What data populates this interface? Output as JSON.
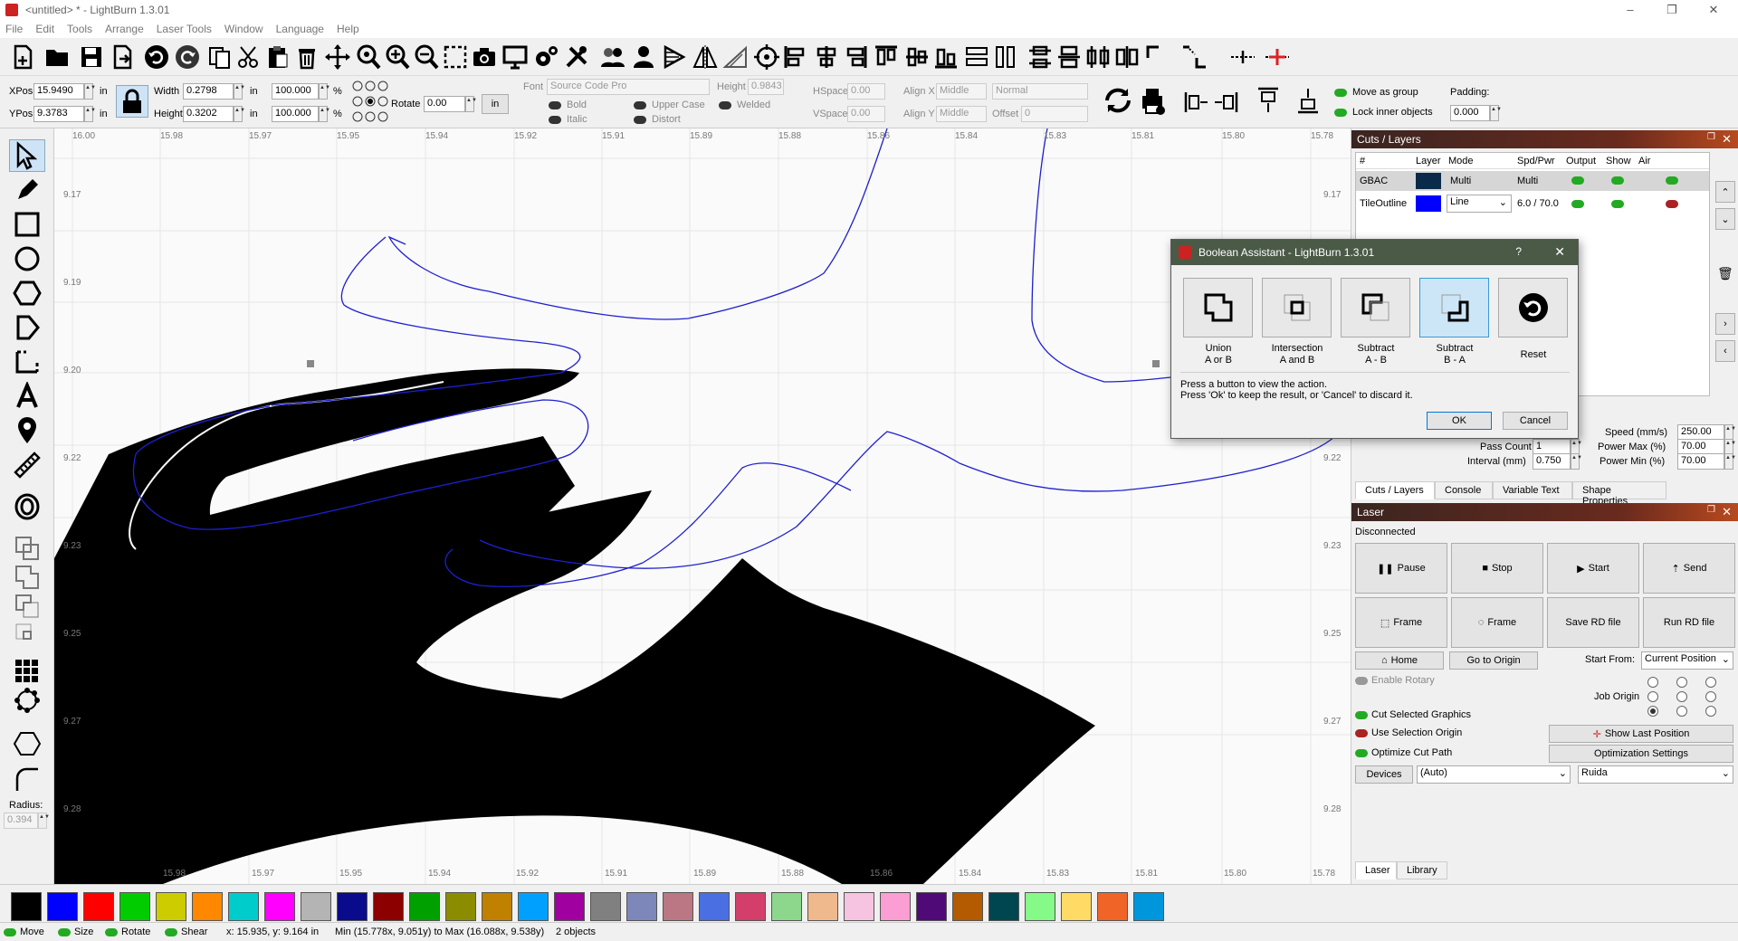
{
  "window": {
    "title": "<untitled> * - LightBurn 1.3.01",
    "minimize": "–",
    "maximize": "❐",
    "close": "✕"
  },
  "menu": [
    "File",
    "Edit",
    "Tools",
    "Arrange",
    "Laser Tools",
    "Window",
    "Language",
    "Help"
  ],
  "position": {
    "xpos_label": "XPos",
    "xpos": "15.9490",
    "ypos_label": "YPos",
    "ypos": "9.3783",
    "unit": "in",
    "width_label": "Width",
    "width": "0.2798",
    "height_label": "Height",
    "height": "0.3202",
    "scale_w": "100.000",
    "scale_h": "100.000",
    "percent": "%",
    "rotate_label": "Rotate",
    "rotate": "0.00",
    "in_button": "in"
  },
  "text_props": {
    "font_label": "Font",
    "font": "Source Code Pro",
    "height_label": "Height",
    "height": "0.9843",
    "hspace_label": "HSpace",
    "hspace": "0.00",
    "vspace_label": "VSpace",
    "vspace": "0.00",
    "alignx_label": "Align X",
    "alignx": "Middle",
    "aligny_label": "Align Y",
    "aligny": "Middle",
    "style": "Normal",
    "offset_label": "Offset",
    "offset": "0",
    "bold": "Bold",
    "italic": "Italic",
    "upper": "Upper Case",
    "distort": "Distort",
    "welded": "Welded"
  },
  "group": {
    "move_as_group": "Move as group",
    "lock_inner": "Lock inner objects",
    "padding_label": "Padding:",
    "padding": "0.000"
  },
  "rulers": {
    "top": [
      "16.00",
      "15.98",
      "15.97",
      "15.95",
      "15.94",
      "15.92",
      "15.91",
      "15.89",
      "15.88",
      "15.86",
      "15.84",
      "15.83",
      "15.81",
      "15.80",
      "15.78"
    ],
    "bottom": [
      "15.98",
      "15.97",
      "15.95",
      "15.94",
      "15.92",
      "15.91",
      "15.89",
      "15.88",
      "15.86",
      "15.84",
      "15.83",
      "15.81",
      "15.80",
      "15.78"
    ],
    "left": [
      "9.17",
      "9.19",
      "9.20",
      "9.22",
      "9.23",
      "9.25",
      "9.27",
      "9.28"
    ],
    "right": [
      "9.17",
      "9.22",
      "9.23",
      "9.25",
      "9.27",
      "9.28"
    ]
  },
  "radius": {
    "label": "Radius:",
    "value": "0.394"
  },
  "cuts": {
    "title": "Cuts / Layers",
    "headers": [
      "#",
      "Layer",
      "Mode",
      "Spd/Pwr",
      "Output",
      "Show",
      "Air"
    ],
    "rows": [
      {
        "name": "GBAC",
        "color": "#0a2a4a",
        "mode": "Multi",
        "spd": "Multi",
        "output": true,
        "show": true,
        "air": true
      },
      {
        "name": "TileOutline",
        "color": "#0000ff",
        "mode": "Line",
        "spd": "6.0 / 70.0",
        "output": true,
        "show": true,
        "air": false
      }
    ],
    "speed_label": "Speed (mm/s)",
    "speed": "250.00",
    "pass_label": "Pass Count",
    "pass": "1",
    "pmax_label": "Power Max (%)",
    "pmax": "70.00",
    "interval_label": "Interval (mm)",
    "interval": "0.750",
    "pmin_label": "Power Min (%)",
    "pmin": "70.00",
    "tabs": [
      "Cuts / Layers",
      "Console",
      "Variable Text",
      "Shape Properties"
    ]
  },
  "laser": {
    "title": "Laser",
    "status": "Disconnected",
    "pause": "Pause",
    "stop": "Stop",
    "start": "Start",
    "send": "Send",
    "frame1": "Frame",
    "frame2": "Frame",
    "save_rd": "Save RD file",
    "run_rd": "Run RD file",
    "home": "Home",
    "go_origin": "Go to Origin",
    "start_from_label": "Start From:",
    "start_from": "Current Position",
    "enable_rotary": "Enable Rotary",
    "job_origin": "Job Origin",
    "cut_selected": "Cut Selected Graphics",
    "use_sel_origin": "Use Selection Origin",
    "optimize": "Optimize Cut Path",
    "show_last": "Show Last Position",
    "opt_settings": "Optimization Settings",
    "devices": "Devices",
    "device": "(Auto)",
    "controller": "Ruida",
    "tabs": [
      "Laser",
      "Library"
    ]
  },
  "dialog": {
    "title": "Boolean Assistant - LightBurn 1.3.01",
    "help": "?",
    "close": "✕",
    "buttons": [
      {
        "l1": "Union",
        "l2": "A or B"
      },
      {
        "l1": "Intersection",
        "l2": "A and B"
      },
      {
        "l1": "Subtract",
        "l2": "A - B"
      },
      {
        "l1": "Subtract",
        "l2": "B - A"
      },
      {
        "l1": "Reset",
        "l2": ""
      }
    ],
    "msg1": "Press a button to view the action.",
    "msg2": "Press 'Ok' to keep the result, or 'Cancel' to discard it.",
    "ok": "OK",
    "cancel": "Cancel"
  },
  "palette": [
    "#000000",
    "#0000ff",
    "#ff0000",
    "#00cc00",
    "#cccc00",
    "#ff8800",
    "#00cccc",
    "#ff00ff",
    "#b4b4b4",
    "#0a0a8c",
    "#8c0000",
    "#00a000",
    "#8c8c00",
    "#c08000",
    "#00a0ff",
    "#a000a0",
    "#808080",
    "#7d87b9",
    "#bb7784",
    "#4a6fe3",
    "#d33f6a",
    "#8cd78c",
    "#f0b98d",
    "#f6c4e1",
    "#fa9ed4",
    "#500a78",
    "#b45a00",
    "#004650",
    "#86fa88",
    "#ffdb66",
    "#f06428",
    "#0096dc"
  ],
  "status": {
    "move": "Move",
    "size": "Size",
    "rotate": "Rotate",
    "shear": "Shear",
    "coords": "x: 15.935, y: 9.164 in",
    "minmax": "Min (15.778x, 9.051y) to Max (16.088x, 9.538y)",
    "objects": "2 objects"
  }
}
